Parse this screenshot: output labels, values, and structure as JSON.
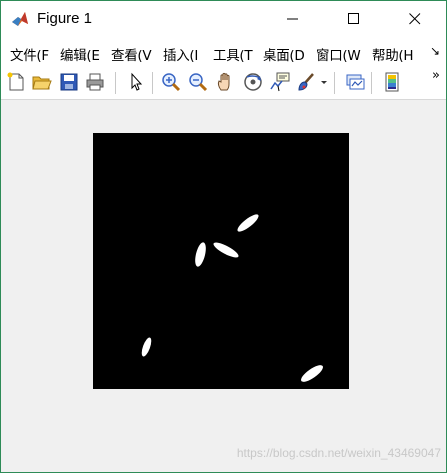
{
  "window": {
    "title": "Figure 1",
    "icon": "matlab-icon"
  },
  "menu": {
    "items": [
      "文件(F",
      "编辑(E",
      "查看(V",
      "插入(I",
      "工具(T",
      "桌面(D",
      "窗口(W",
      "帮助(H"
    ],
    "more": "↘"
  },
  "toolbar": {
    "buttons": [
      "new-figure-icon",
      "open-file-icon",
      "save-icon",
      "print-icon",
      "select-arrow-icon",
      "zoom-in-icon",
      "zoom-out-icon",
      "pan-hand-icon",
      "rotate-3d-icon",
      "data-cursor-icon",
      "brush-icon",
      "link-plot-icon",
      "insert-colorbar-icon"
    ],
    "more": "»"
  },
  "figure": {
    "background": "#000000",
    "foreground": "#ffffff"
  },
  "watermark": "https://blog.csdn.net/weixin_43469047"
}
